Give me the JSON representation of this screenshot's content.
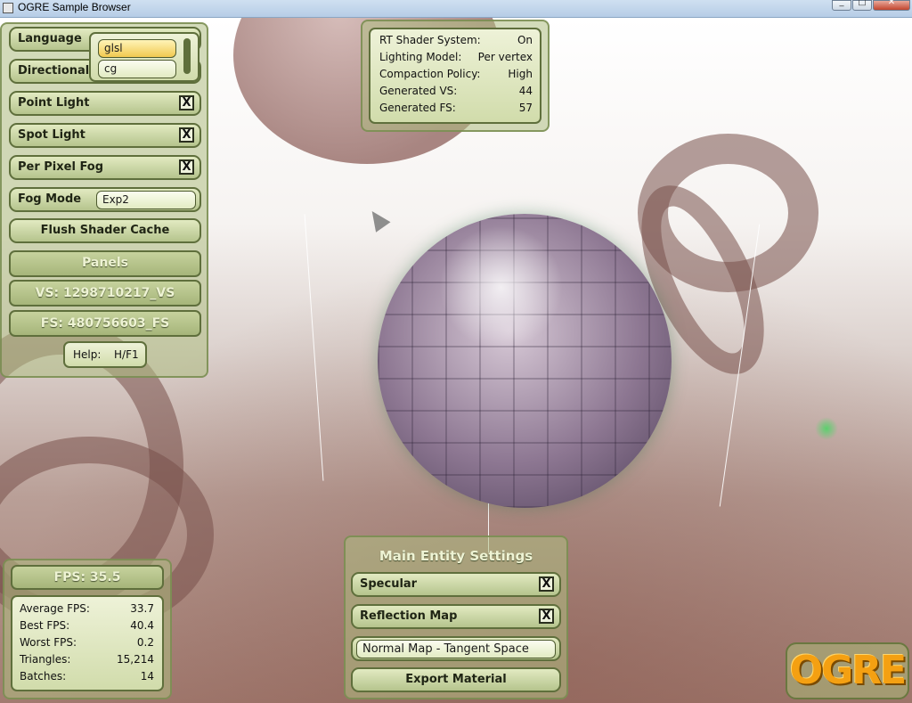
{
  "window": {
    "title": "OGRE Sample Browser"
  },
  "left_panel": {
    "language_label": "Language",
    "language_options": [
      "glsl",
      "cg"
    ],
    "directional_label": "Directional",
    "point_light_label": "Point Light",
    "spot_light_label": "Spot Light",
    "per_pixel_fog_label": "Per Pixel Fog",
    "check_mark": "X",
    "fog_mode_label": "Fog Mode",
    "fog_mode_value": "Exp2",
    "flush_button": "Flush Shader Cache",
    "panels_heading": "Panels",
    "vs_label": "VS: 1298710217_VS",
    "fs_label": "FS: 480756603_FS",
    "help_label": "Help:",
    "help_value": "H/F1"
  },
  "shader_stats": {
    "rows": [
      {
        "label": "RT Shader System:",
        "value": "On"
      },
      {
        "label": "Lighting Model:",
        "value": "Per vertex"
      },
      {
        "label": "Compaction Policy:",
        "value": "High"
      },
      {
        "label": "Generated VS:",
        "value": "44"
      },
      {
        "label": "Generated FS:",
        "value": "57"
      }
    ]
  },
  "fps_panel": {
    "fps_heading": "FPS: 35.5",
    "rows": [
      {
        "label": "Average FPS:",
        "value": "33.7"
      },
      {
        "label": "Best FPS:",
        "value": "40.4"
      },
      {
        "label": "Worst FPS:",
        "value": "0.2"
      },
      {
        "label": "Triangles:",
        "value": "15,214"
      },
      {
        "label": "Batches:",
        "value": "14"
      }
    ]
  },
  "entity_panel": {
    "heading": "Main Entity Settings",
    "specular_label": "Specular",
    "reflection_label": "Reflection Map",
    "normal_map_value": "Normal Map - Tangent Space",
    "export_button": "Export Material"
  },
  "logo": {
    "text": "OGRE"
  },
  "colors": {
    "widget_fill": "#c7d39f",
    "widget_border": "#5f6f3c",
    "highlight": "#f1c950",
    "logo": "#f4a012"
  }
}
